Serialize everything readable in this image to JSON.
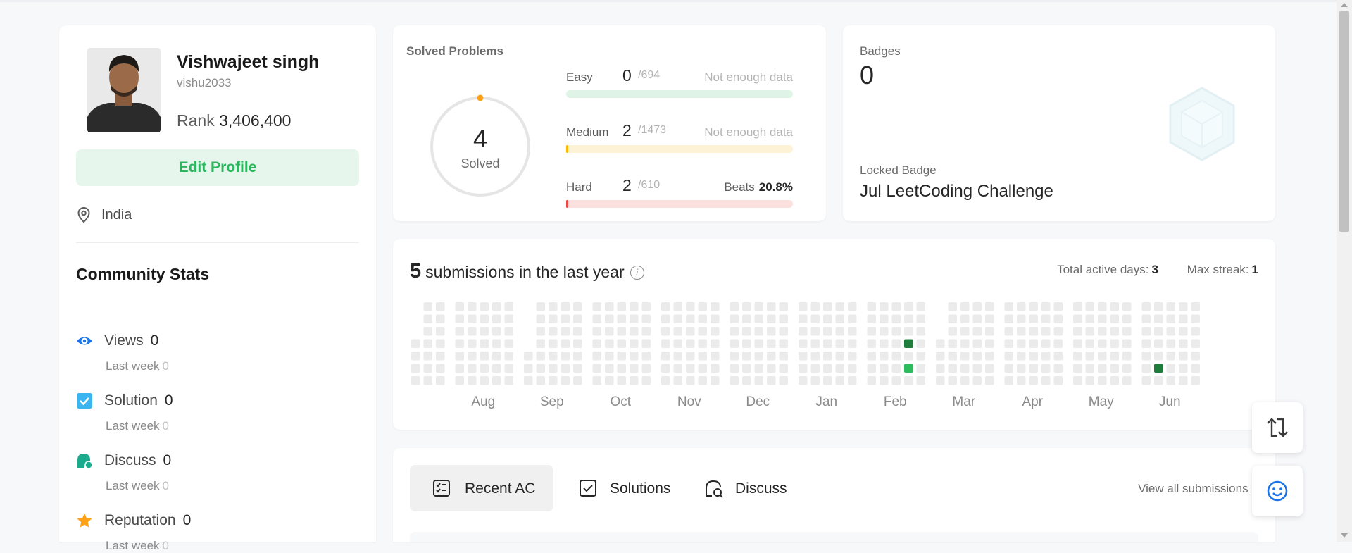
{
  "profile": {
    "name": "Vishwajeet singh",
    "username": "vishu2033",
    "rank_label": "Rank",
    "rank_value": "3,406,400",
    "edit_label": "Edit Profile",
    "location": "India"
  },
  "community": {
    "title": "Community Stats",
    "stats": [
      {
        "label": "Views",
        "value": "0",
        "sub_label": "Last week",
        "sub_value": "0",
        "icon": "eye-icon",
        "color": "#1a73e8"
      },
      {
        "label": "Solution",
        "value": "0",
        "sub_label": "Last week",
        "sub_value": "0",
        "icon": "checkbox-icon",
        "color": "#3ab5f0"
      },
      {
        "label": "Discuss",
        "value": "0",
        "sub_label": "Last week",
        "sub_value": "0",
        "icon": "discuss-icon",
        "color": "#1aaa8c"
      },
      {
        "label": "Reputation",
        "value": "0",
        "sub_label": "Last week",
        "sub_value": "0",
        "icon": "star-icon",
        "color": "#ffa116"
      }
    ]
  },
  "solved": {
    "title": "Solved Problems",
    "total": "4",
    "total_label": "Solved",
    "difficulties": [
      {
        "label": "Easy",
        "count": "0",
        "total": "/694",
        "note": "Not enough data",
        "track": "#dff4e7",
        "fill": "#2db55d",
        "progress": 0.0
      },
      {
        "label": "Medium",
        "count": "2",
        "total": "/1473",
        "note": "Not enough data",
        "track": "#fdf1d6",
        "fill": "#ffb800",
        "progress": 0.0014
      },
      {
        "label": "Hard",
        "count": "2",
        "total": "/610",
        "beats_label": "Beats",
        "beats_value": "20.8%",
        "track": "#fbe0dd",
        "fill": "#ef4743",
        "progress": 0.0033
      }
    ]
  },
  "badges": {
    "title": "Badges",
    "count": "0",
    "locked_label": "Locked Badge",
    "locked_name": "Jul LeetCoding Challenge"
  },
  "submissions": {
    "count": "5",
    "label": "submissions in the last year",
    "active_days_label": "Total active days:",
    "active_days": "3",
    "max_streak_label": "Max streak:",
    "max_streak": "1",
    "months": [
      "Aug",
      "Sep",
      "Oct",
      "Nov",
      "Dec",
      "Jan",
      "Feb",
      "Mar",
      "Apr",
      "May",
      "Jun"
    ],
    "colors": {
      "empty": "#ebebeb",
      "low": "#2cbb5d",
      "high": "#1f7d3b"
    }
  },
  "tabs": {
    "items": [
      {
        "label": "Recent AC",
        "icon": "recent-ac-icon"
      },
      {
        "label": "Solutions",
        "icon": "solutions-icon"
      },
      {
        "label": "Discuss",
        "icon": "discuss-tab-icon"
      }
    ],
    "view_all": "View all submissions"
  }
}
